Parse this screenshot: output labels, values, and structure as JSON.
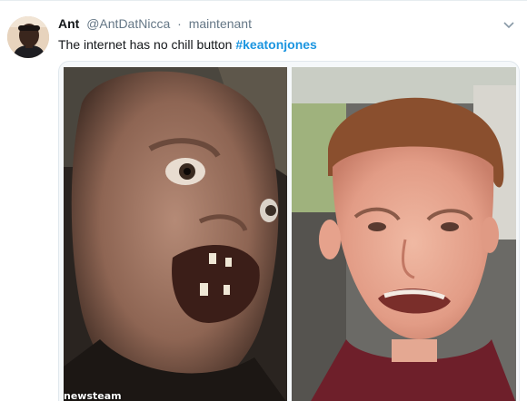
{
  "tweet": {
    "display_name": "Ant",
    "handle": "@AntDatNicca",
    "separator": "·",
    "timestamp": "maintenant",
    "text": "The internet has no chill button",
    "hashtag": "#keatonjones"
  },
  "media": {
    "left_image": "film character face (Sloth) with open mouth",
    "right_image": "crying boy in a car",
    "watermark": "newsteam"
  },
  "icons": {
    "caret": "chevron-down-icon"
  },
  "colors": {
    "name": "#14171a",
    "meta": "#657786",
    "hashtag": "#1b95e0",
    "border": "#e1e8ed"
  }
}
